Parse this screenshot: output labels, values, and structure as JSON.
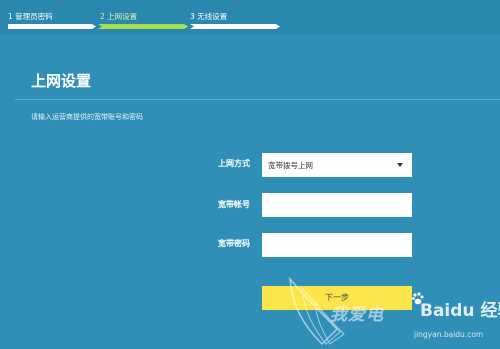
{
  "steps": [
    {
      "label": "1 管理员密码"
    },
    {
      "label": "2 上网设置"
    },
    {
      "label": "3 无线设置"
    }
  ],
  "page": {
    "title": "上网设置",
    "hint": "请输入运营商提供的宽带账号和密码"
  },
  "form": {
    "mode_label": "上网方式",
    "mode_value": "宽带拨号上网",
    "account_label": "宽带帐号",
    "account_value": "",
    "password_label": "宽带密码",
    "password_value": "",
    "next_label": "下一步"
  },
  "watermark": {
    "text": "我爱电",
    "brand": "Baidu 经验",
    "url": "jingyan.baidu.com"
  },
  "colors": {
    "background": "#2f8fb7",
    "active_step": "#a7e04c",
    "button": "#fbe54a"
  }
}
